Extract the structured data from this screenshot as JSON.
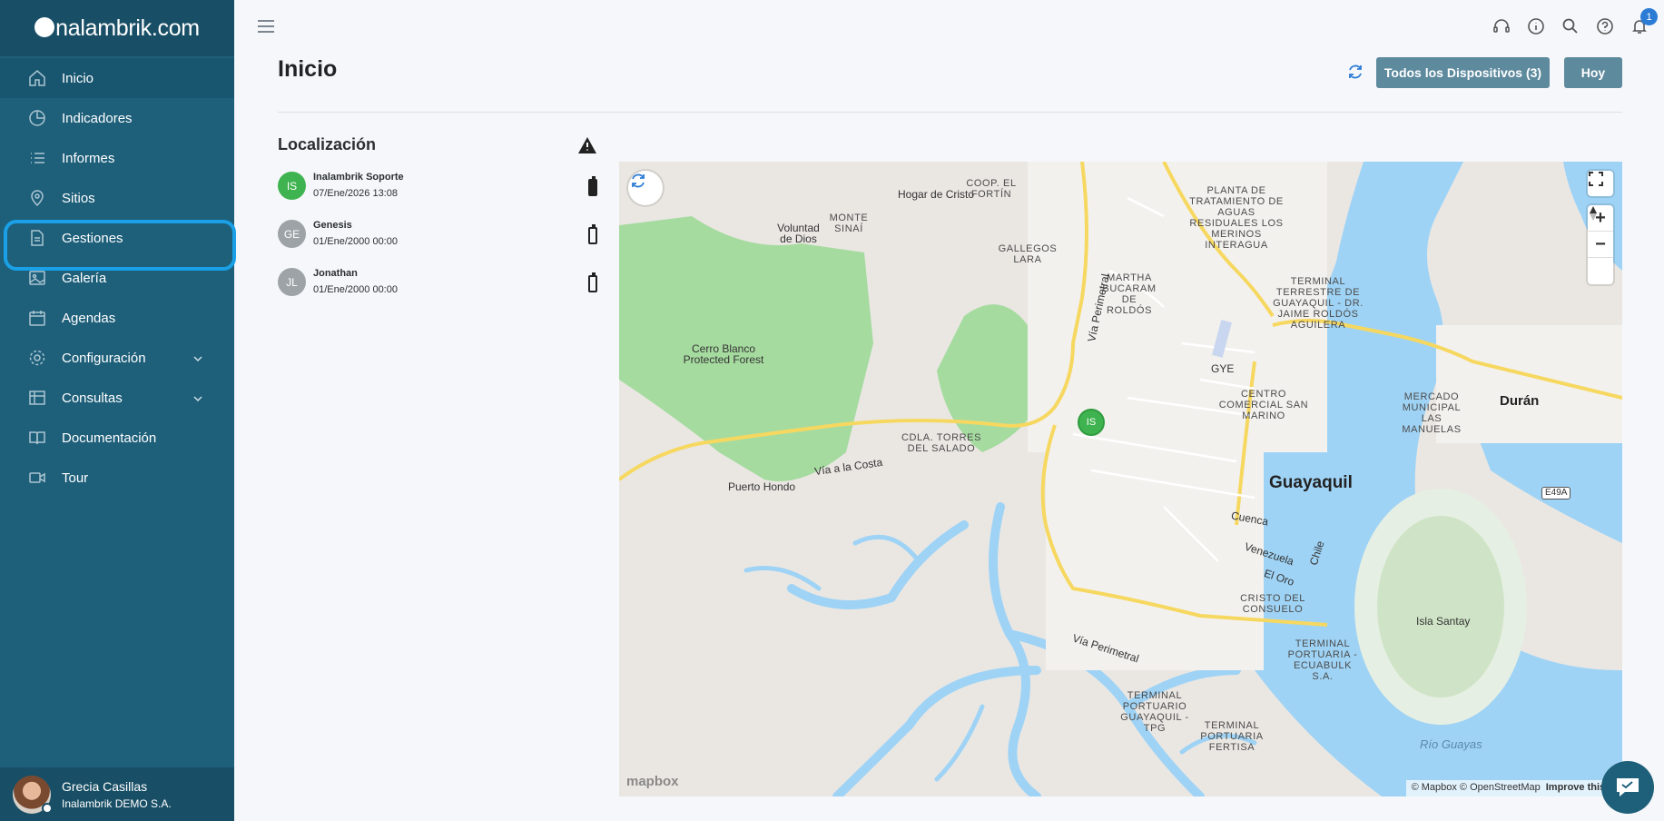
{
  "brand": {
    "logo_text": "nalambrik.com"
  },
  "sidebar": {
    "items": [
      {
        "label": "Inicio",
        "icon": "home-icon"
      },
      {
        "label": "Indicadores",
        "icon": "pie-chart-icon"
      },
      {
        "label": "Informes",
        "icon": "list-icon"
      },
      {
        "label": "Sitios",
        "icon": "location-pin-icon"
      },
      {
        "label": "Gestiones",
        "icon": "document-icon"
      },
      {
        "label": "Galería",
        "icon": "image-icon"
      },
      {
        "label": "Agendas",
        "icon": "calendar-icon"
      },
      {
        "label": "Configuración",
        "icon": "gear-icon"
      },
      {
        "label": "Consultas",
        "icon": "table-icon"
      },
      {
        "label": "Documentación",
        "icon": "book-icon"
      },
      {
        "label": "Tour",
        "icon": "video-icon"
      }
    ],
    "user": {
      "name": "Grecia Casillas",
      "org": "Inalambrik DEMO S.A."
    }
  },
  "topbar": {
    "notification_count": "1"
  },
  "header": {
    "title": "Inicio",
    "devices_button": "Todos los Dispositivos (3)",
    "today_button": "Hoy"
  },
  "location": {
    "title": "Localización",
    "devices": [
      {
        "initials": "IS",
        "name": "Inalambrik Soporte",
        "date": "07/Ene/2026 13:08",
        "battery": "full"
      },
      {
        "initials": "GE",
        "name": "Genesis",
        "date": "01/Ene/2000 00:00",
        "battery": "empty"
      },
      {
        "initials": "JL",
        "name": "Jonathan",
        "date": "01/Ene/2000 00:00",
        "battery": "empty"
      }
    ]
  },
  "map": {
    "marker": "IS",
    "labels": {
      "guayaquil": "Guayaquil",
      "duran": "Durán",
      "hogar": "Hogar de Cristo",
      "voluntad": "Voluntad de Dios",
      "monte": "MONTE SINAÍ",
      "coop": "COOP. EL FORTÍN",
      "gallegos": "GALLEGOS LARA",
      "martha": "MARTHA BUCARAM DE ROLDÓS",
      "planta": "PLANTA DE TRATAMIENTO DE AGUAS RESIDUALES LOS MERINOS INTERAGUA",
      "terminal": "TERMINAL TERRESTRE DE GUAYAQUIL - DR. JAIME ROLDÓS AGUILERA",
      "gye": "GYE",
      "centro": "CENTRO COMERCIAL SAN MARINO",
      "mercado": "MERCADO MUNICIPAL LAS MANUELAS",
      "cerro": "Cerro Blanco Protected Forest",
      "cdla": "CDLA. TORRES DEL SALADO",
      "via_costa": "Vía a la Costa",
      "puerto": "Puerto Hondo",
      "perimetral": "Vía Perimetral",
      "perimetral2": "Vía Perimetral",
      "cuenca": "Cuenca",
      "venezuela": "Venezuela",
      "eloro": "El Oro",
      "chile": "Chile",
      "cristo": "CRISTO DEL CONSUELO",
      "terminal_portuaria": "TERMINAL PORTUARIA - ECUABULK S.A.",
      "terminal_tpg": "TERMINAL PORTUARIO GUAYAQUIL - TPG",
      "terminal_fertisa": "TERMINAL PORTUARIA FERTISA",
      "isla": "Isla Santay",
      "rio": "Río Guayas",
      "e49a": "E49A"
    },
    "attribution": "© Mapbox © OpenStreetMap",
    "improve": "Improve this m",
    "logo": "mapbox"
  }
}
